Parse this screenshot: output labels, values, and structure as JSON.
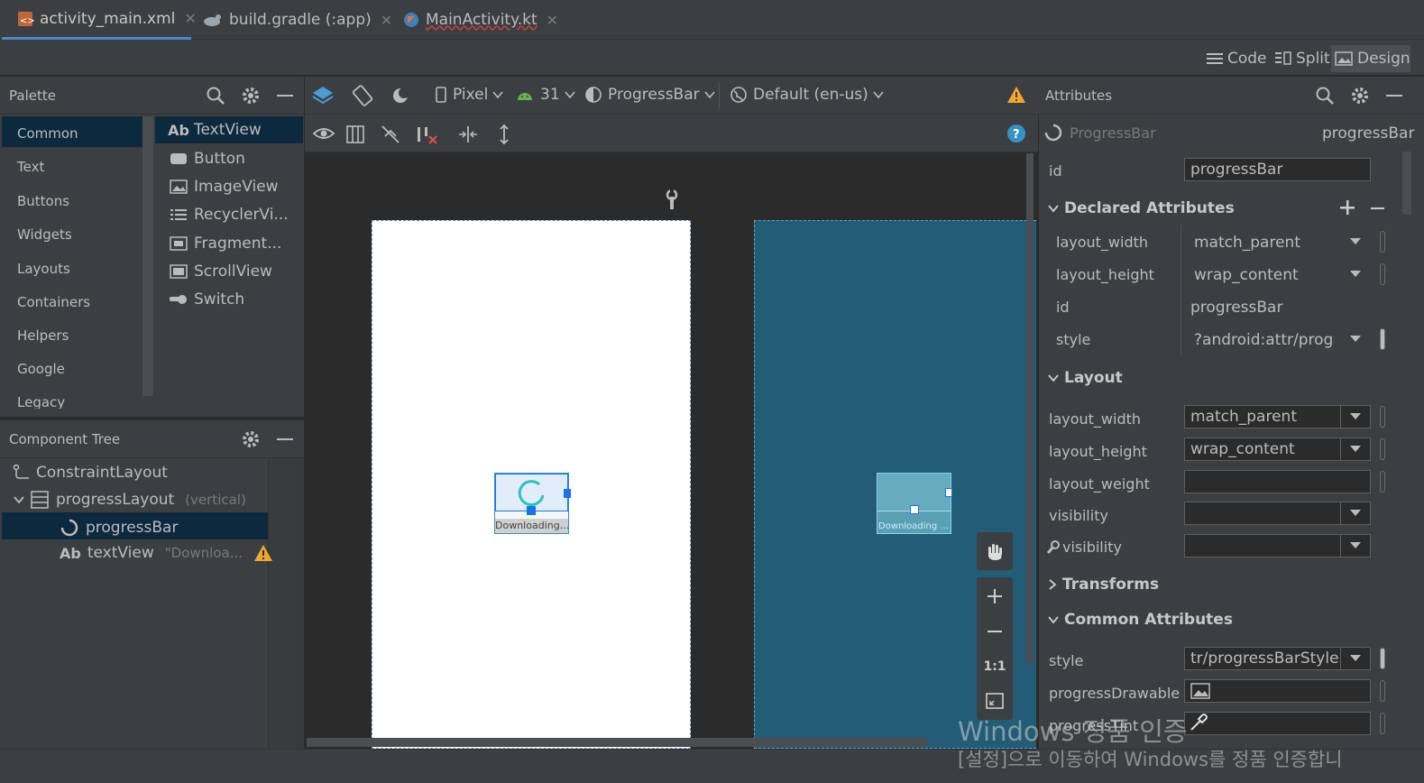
{
  "tabs": [
    {
      "label": "activity_main.xml",
      "active": true
    },
    {
      "label": "build.gradle (:app)",
      "active": false
    },
    {
      "label": "MainActivity.kt",
      "active": false
    }
  ],
  "modes": {
    "code": "Code",
    "split": "Split",
    "design": "Design"
  },
  "palette": {
    "title": "Palette",
    "categories": [
      "Common",
      "Text",
      "Buttons",
      "Widgets",
      "Layouts",
      "Containers",
      "Helpers",
      "Google",
      "Legacy"
    ],
    "items": [
      {
        "label": "TextView",
        "icon": "textview-icon"
      },
      {
        "label": "Button",
        "icon": "button-icon"
      },
      {
        "label": "ImageView",
        "icon": "image-icon"
      },
      {
        "label": "RecyclerVi...",
        "icon": "list-icon"
      },
      {
        "label": "Fragment...",
        "icon": "fragment-icon"
      },
      {
        "label": "ScrollView",
        "icon": "scrollview-icon"
      },
      {
        "label": "Switch",
        "icon": "switch-icon"
      }
    ]
  },
  "toolbar": {
    "device": "Pixel",
    "api": "31",
    "theme": "ProgressBar",
    "locale": "Default (en-us)"
  },
  "component_tree": {
    "title": "Component Tree",
    "rows": [
      {
        "label": "ConstraintLayout",
        "hint": ""
      },
      {
        "label": "progressLayout",
        "hint": "(vertical)"
      },
      {
        "label": "progressBar",
        "hint": ""
      },
      {
        "label": "textView",
        "hint": "\"Downloa..."
      }
    ]
  },
  "canvas": {
    "design_text": "Downloading...",
    "blueprint_text": "Downloading ...",
    "zoom_ratio": "1:1"
  },
  "attributes": {
    "title": "Attributes",
    "component_type": "ProgressBar",
    "component_id": "progressBar",
    "id_label": "id",
    "id_value": "progressBar",
    "declared_title": "Declared Attributes",
    "declared": [
      {
        "name": "layout_width",
        "value": "match_parent"
      },
      {
        "name": "layout_height",
        "value": "wrap_content"
      },
      {
        "name": "id",
        "value": "progressBar"
      },
      {
        "name": "style",
        "value": "?android:attr/progr"
      }
    ],
    "layout_title": "Layout",
    "layout": [
      {
        "name": "layout_width",
        "value": "match_parent"
      },
      {
        "name": "layout_height",
        "value": "wrap_content"
      },
      {
        "name": "layout_weight",
        "value": ""
      },
      {
        "name": "visibility",
        "value": ""
      },
      {
        "name": "visibility",
        "value": ""
      }
    ],
    "transforms_title": "Transforms",
    "common_title": "Common Attributes",
    "common": [
      {
        "name": "style",
        "value": "tr/progressBarStyle"
      },
      {
        "name": "progressDrawable",
        "value": ""
      },
      {
        "name": "progressTint",
        "value": ""
      }
    ]
  },
  "watermark": {
    "line1": "Windows 정품 인증",
    "line2": "[설정]으로 이동하여 Windows를 정품 인증합니"
  },
  "colors": {
    "accent": "#4a88c7",
    "selection": "#0d293e",
    "blueprint": "#1f5f78",
    "warning": "#f0a732"
  }
}
